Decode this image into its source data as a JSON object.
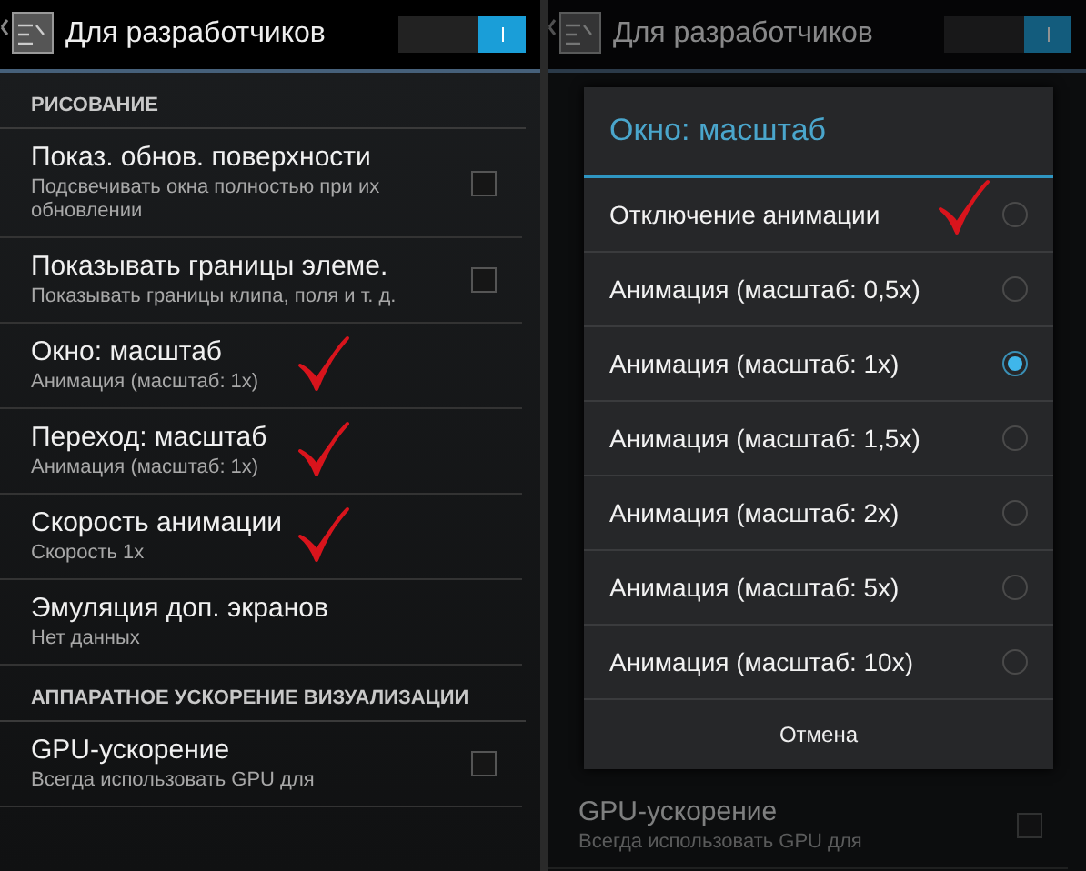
{
  "left_screen": {
    "action_bar": {
      "title": "Для разработчиков",
      "switch_on": true
    },
    "sections": [
      {
        "header": "РИСОВАНИЕ",
        "items": [
          {
            "kind": "checkbox",
            "title": "Показ. обнов. поверхности",
            "summary": "Подсвечивать окна полностью при их обновлении",
            "checked": false,
            "annotated": false
          },
          {
            "kind": "checkbox",
            "title": "Показывать границы элеме.",
            "summary": "Показывать границы клипа, поля и т. д.",
            "checked": false,
            "annotated": false
          },
          {
            "kind": "value",
            "title": "Окно: масштаб",
            "summary": "Анимация (масштаб: 1x)",
            "annotated": true
          },
          {
            "kind": "value",
            "title": "Переход: масштаб",
            "summary": "Анимация (масштаб: 1x)",
            "annotated": true
          },
          {
            "kind": "value",
            "title": "Скорость анимации",
            "summary": "Скорость 1x",
            "annotated": true
          },
          {
            "kind": "value",
            "title": "Эмуляция доп. экранов",
            "summary": "Нет данных",
            "annotated": false
          }
        ]
      },
      {
        "header": "АППАРАТНОЕ УСКОРЕНИЕ ВИЗУАЛИЗАЦИИ",
        "items": [
          {
            "kind": "checkbox",
            "title": "GPU-ускорение",
            "summary": "Всегда использовать GPU для",
            "checked": false,
            "annotated": false
          }
        ]
      }
    ]
  },
  "right_screen": {
    "action_bar": {
      "title": "Для разработчиков",
      "switch_on": true
    },
    "background_items": [
      {
        "kind": "checkbox",
        "title": "GPU-ускорение",
        "summary": "Всегда использовать GPU для",
        "checked": false,
        "annotated": false
      }
    ],
    "dialog": {
      "title": "Окно: масштаб",
      "options": [
        {
          "label": "Отключение анимации",
          "selected": false,
          "annotated": true
        },
        {
          "label": "Анимация (масштаб: 0,5x)",
          "selected": false,
          "annotated": false
        },
        {
          "label": "Анимация (масштаб: 1x)",
          "selected": true,
          "annotated": false
        },
        {
          "label": "Анимация (масштаб: 1,5x)",
          "selected": false,
          "annotated": false
        },
        {
          "label": "Анимация (масштаб: 2x)",
          "selected": false,
          "annotated": false
        },
        {
          "label": "Анимация (масштаб: 5x)",
          "selected": false,
          "annotated": false
        },
        {
          "label": "Анимация (масштаб: 10x)",
          "selected": false,
          "annotated": false
        }
      ],
      "cancel": "Отмена"
    }
  }
}
